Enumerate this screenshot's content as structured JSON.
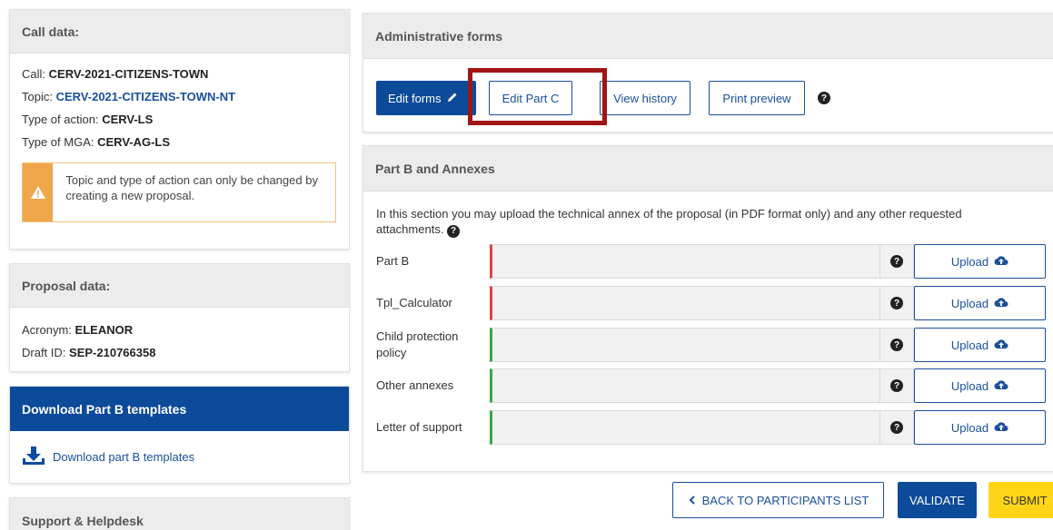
{
  "call": {
    "title": "Call data:",
    "call_label": "Call:",
    "call_value": "CERV-2021-CITIZENS-TOWN",
    "topic_label": "Topic:",
    "topic_value": "CERV-2021-CITIZENS-TOWN-NT",
    "action_label": "Type of action:",
    "action_value": "CERV-LS",
    "mga_label": "Type of MGA:",
    "mga_value": "CERV-AG-LS",
    "warning": "Topic and type of action can only be changed by creating a new proposal.",
    "warning_icon": "warning-triangle-icon"
  },
  "proposal": {
    "title": "Proposal data:",
    "acronym_label": "Acronym:",
    "acronym_value": "ELEANOR",
    "draft_label": "Draft ID:",
    "draft_value": "SEP-210766358"
  },
  "download": {
    "title": "Download Part B templates",
    "link": "Download part B templates",
    "icon": "download-icon"
  },
  "support": {
    "title": "Support & Helpdesk"
  },
  "admin": {
    "title": "Administrative forms",
    "edit_forms": "Edit forms",
    "edit_part_c": "Edit Part C",
    "view_history": "View history",
    "print_preview": "Print preview",
    "help_glyph": "?"
  },
  "partb": {
    "title": "Part B and Annexes",
    "intro": "In this section you may upload the technical annex of the proposal (in PDF format only) and any other requested attachments.",
    "upload_label": "Upload",
    "rows": [
      {
        "label": "Part B",
        "status": "required"
      },
      {
        "label": "Tpl_Calculator",
        "status": "required"
      },
      {
        "label": "Child protection policy",
        "status": "ok"
      },
      {
        "label": "Other annexes",
        "status": "ok"
      },
      {
        "label": "Letter of support",
        "status": "ok"
      }
    ]
  },
  "actions": {
    "back": "BACK TO PARTICIPANTS LIST",
    "validate": "VALIDATE",
    "submit": "SUBMIT"
  },
  "colors": {
    "primary": "#0c4a9a",
    "warning": "#f0a64a",
    "highlight": "#a11515",
    "required": "#e04444",
    "ok": "#3aa64a",
    "submit": "#ffd617"
  }
}
